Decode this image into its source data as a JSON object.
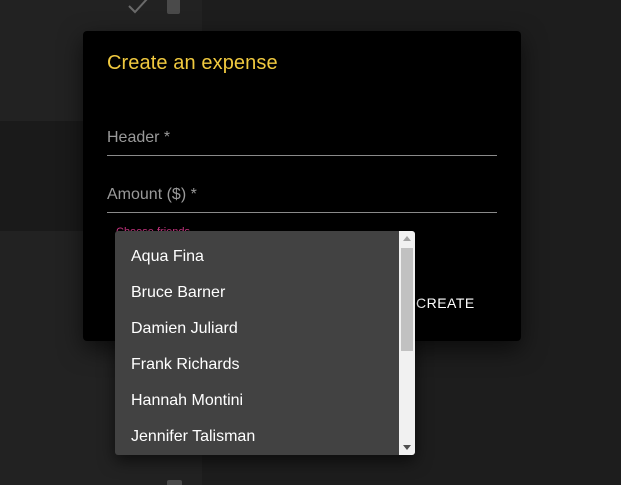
{
  "dialog": {
    "title": "Create an expense",
    "header_label": "Header *",
    "amount_label": "Amount ($) *",
    "choose_friends_label": "Choose friends",
    "create_label": "CREATE"
  },
  "friends_dropdown": {
    "options": [
      "Aqua Fina",
      "Bruce Barner",
      "Damien Juliard",
      "Frank Richards",
      "Hannah Montini",
      "Jennifer Talisman"
    ]
  },
  "colors": {
    "title": "#f0c93f",
    "choose_label": "#d6398a",
    "dialog_bg": "#000000",
    "dropdown_bg": "#424242"
  },
  "icons": [
    "check-icon",
    "trash-icon"
  ]
}
